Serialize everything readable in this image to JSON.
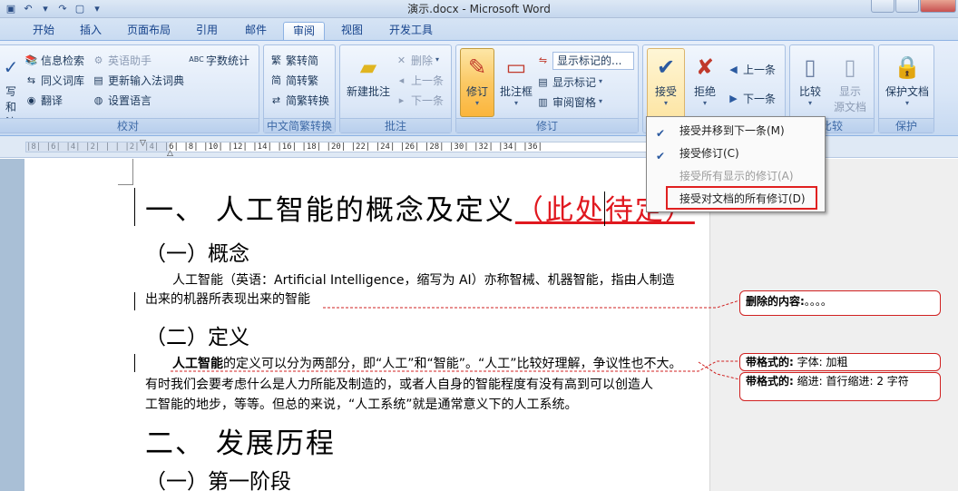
{
  "window": {
    "title": "演示.docx - Microsoft Word"
  },
  "tabs": [
    "开始",
    "插入",
    "页面布局",
    "引用",
    "邮件",
    "审阅",
    "视图",
    "开发工具"
  ],
  "active_tab": "审阅",
  "ribbon": {
    "proofing": {
      "label": "校对",
      "left_big": [
        "写和",
        "法"
      ],
      "buttons": [
        "信息检索",
        "英语助手",
        "字数统计",
        "同义词库",
        "更新输入法词典",
        "翻译",
        "设置语言"
      ]
    },
    "chinese": {
      "label": "中文简繁转换",
      "buttons": [
        "繁转简",
        "简转繁",
        "简繁转换"
      ]
    },
    "comments": {
      "label": "批注",
      "new_comment": "新建批注",
      "delete": "删除",
      "previous": "上一条",
      "next": "下一条"
    },
    "tracking": {
      "label": "修订",
      "track_changes": "修订",
      "balloons": "批注框",
      "display_combo": "显示标记的...",
      "show_markup": "显示标记",
      "reviewing_pane": "审阅窗格"
    },
    "changes": {
      "accept": "接受",
      "reject": "拒绝",
      "previous": "上一条",
      "next": "下一条"
    },
    "compare": {
      "label": "比较",
      "compare": "比较",
      "show_source": [
        "显示",
        "源文档"
      ]
    },
    "protect": {
      "label": "保护",
      "protect_doc": "保护文档"
    }
  },
  "ruler_marks": "|8|  |6|  |4|  |2|  | |  |2|  |4|  |6|  |8|  |10|  |12|  |14|  |16|  |18|  |20|  |22|  |24|  |26|  |28|  |30|  |32|  |34|  |36|",
  "accept_menu": {
    "items": [
      {
        "label": "接受并移到下一条(M)",
        "enabled": true
      },
      {
        "label": "接受修订(C)",
        "enabled": true
      },
      {
        "label": "接受所有显示的修订(A)",
        "enabled": false
      },
      {
        "label": "接受对文档的所有修订(D)",
        "enabled": true
      }
    ]
  },
  "document": {
    "h1_a": "一、  人工智能的概念及定义",
    "h1_a_inserted": "（此处待定）",
    "h2_concept": "（一）概念",
    "concept_line1": "人工智能（英语：Artificial Intelligence，缩写为 AI）亦称智械、机器智能，指由人制造",
    "concept_line2": "出来的机器所表现出来的智能",
    "h2_definition": "（二）定义",
    "def_line1_bold": "人工智能",
    "def_line1_rest": "的定义可以分为两部分，即“人工”和“智能”。“人工”比较好理解，争议性也不大。",
    "def_line2": "有时我们会要考虑什么是人力所能及制造的，或者人自身的智能程度有没有高到可以创造人",
    "def_line3": "工智能的地步，等等。但总的来说，“人工系统”就是通常意义下的人工系统。",
    "h1_b": "二、  发展历程",
    "h2_stage1": "（一）第一阶段"
  },
  "balloons": {
    "deleted": {
      "label": "删除的内容:",
      "text": "。。。。"
    },
    "format_font": {
      "label": "带格式的:",
      "text": "字体: 加粗"
    },
    "format_indent": {
      "label": "带格式的:",
      "text": "缩进: 首行缩进:  2 字符"
    }
  }
}
